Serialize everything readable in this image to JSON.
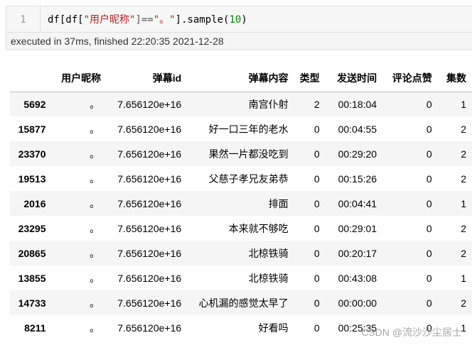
{
  "cell": {
    "line_number": "1",
    "code": {
      "p1": "df[df[",
      "s1": "\"用户昵称\"",
      "p2": "]==",
      "s2": "\"。\"",
      "p3": "].sample(",
      "n1": "10",
      "p4": ")"
    },
    "exec_info": "executed in 37ms, finished 22:20:35 2021-12-28"
  },
  "table": {
    "columns": [
      "",
      "用户昵称",
      "弹幕id",
      "弹幕内容",
      "类型",
      "发送时间",
      "评论点赞",
      "集数"
    ],
    "rows": [
      {
        "index": "5692",
        "nick": "。",
        "id": "7.656120e+16",
        "content": "南宫仆射",
        "type": "2",
        "time": "00:18:04",
        "likes": "0",
        "episode": "1"
      },
      {
        "index": "15877",
        "nick": "。",
        "id": "7.656120e+16",
        "content": "好一口三年的老水",
        "type": "0",
        "time": "00:04:55",
        "likes": "0",
        "episode": "2"
      },
      {
        "index": "23370",
        "nick": "。",
        "id": "7.656120e+16",
        "content": "果然一片都没吃到",
        "type": "0",
        "time": "00:29:20",
        "likes": "0",
        "episode": "2"
      },
      {
        "index": "19513",
        "nick": "。",
        "id": "7.656120e+16",
        "content": "父慈子孝兄友弟恭",
        "type": "0",
        "time": "00:15:26",
        "likes": "0",
        "episode": "2"
      },
      {
        "index": "2016",
        "nick": "。",
        "id": "7.656120e+16",
        "content": "排面",
        "type": "0",
        "time": "00:04:41",
        "likes": "0",
        "episode": "1"
      },
      {
        "index": "23295",
        "nick": "。",
        "id": "7.656120e+16",
        "content": "本来就不够吃",
        "type": "0",
        "time": "00:29:01",
        "likes": "0",
        "episode": "2"
      },
      {
        "index": "20865",
        "nick": "。",
        "id": "7.656120e+16",
        "content": "北椋铁骑",
        "type": "0",
        "time": "00:20:17",
        "likes": "0",
        "episode": "2"
      },
      {
        "index": "13855",
        "nick": "。",
        "id": "7.656120e+16",
        "content": "北椋铁骑",
        "type": "0",
        "time": "00:43:08",
        "likes": "0",
        "episode": "1"
      },
      {
        "index": "14733",
        "nick": "。",
        "id": "7.656120e+16",
        "content": "心机漏的感觉太早了",
        "type": "0",
        "time": "00:00:00",
        "likes": "0",
        "episode": "2"
      },
      {
        "index": "8211",
        "nick": "。",
        "id": "7.656120e+16",
        "content": "好看吗",
        "type": "0",
        "time": "00:25:35",
        "likes": "0",
        "episode": "1"
      }
    ]
  },
  "watermark": "CSDN @流沙沙尘居士"
}
